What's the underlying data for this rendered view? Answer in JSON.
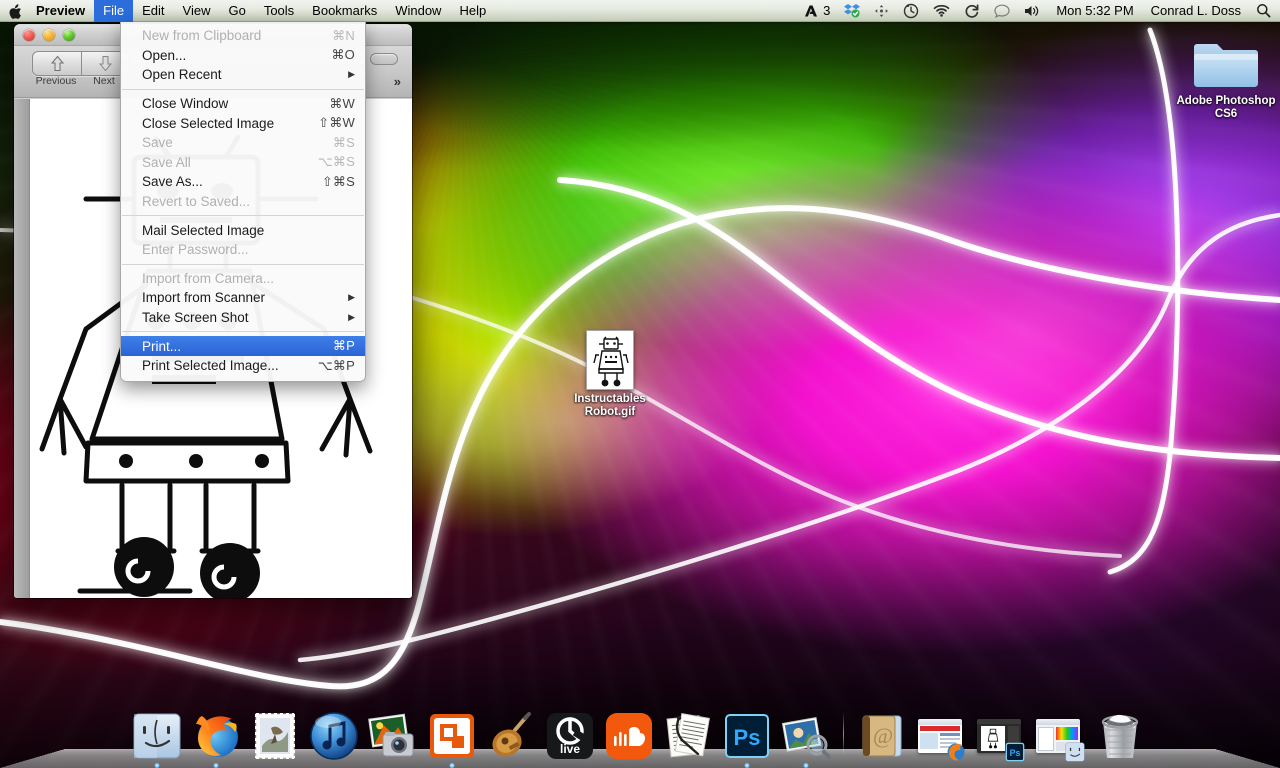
{
  "menubar": {
    "apple_icon": "apple-logo",
    "app_name": "Preview",
    "items": [
      {
        "label": "File",
        "active": true
      },
      {
        "label": "Edit",
        "active": false
      },
      {
        "label": "View",
        "active": false
      },
      {
        "label": "Go",
        "active": false
      },
      {
        "label": "Tools",
        "active": false
      },
      {
        "label": "Bookmarks",
        "active": false
      },
      {
        "label": "Window",
        "active": false
      },
      {
        "label": "Help",
        "active": false
      }
    ],
    "status_icons": [
      {
        "name": "adobe-creative-cloud-icon",
        "glyph": "A"
      },
      {
        "name": "notification-count",
        "glyph": "3"
      },
      {
        "name": "dropbox-icon",
        "glyph": "dropbox"
      },
      {
        "name": "bluetooth-share-icon",
        "glyph": "share"
      },
      {
        "name": "time-machine-icon",
        "glyph": "clock"
      },
      {
        "name": "wifi-icon",
        "glyph": "wifi"
      },
      {
        "name": "sync-icon",
        "glyph": "sync"
      },
      {
        "name": "messages-icon",
        "glyph": "bubble"
      },
      {
        "name": "volume-icon",
        "glyph": "speaker"
      }
    ],
    "clock": "Mon 5:32 PM",
    "user": "Conrad L. Doss",
    "search_icon": "spotlight-search-icon"
  },
  "file_menu": {
    "title": "File",
    "groups": [
      [
        {
          "label": "New from Clipboard",
          "key": "⌘N",
          "disabled": true,
          "submenu": false,
          "selected": false
        },
        {
          "label": "Open...",
          "key": "⌘O",
          "disabled": false,
          "submenu": false,
          "selected": false
        },
        {
          "label": "Open Recent",
          "key": "",
          "disabled": false,
          "submenu": true,
          "selected": false
        }
      ],
      [
        {
          "label": "Close Window",
          "key": "⌘W",
          "disabled": false,
          "submenu": false,
          "selected": false
        },
        {
          "label": "Close Selected Image",
          "key": "⇧⌘W",
          "disabled": false,
          "submenu": false,
          "selected": false
        },
        {
          "label": "Save",
          "key": "⌘S",
          "disabled": true,
          "submenu": false,
          "selected": false
        },
        {
          "label": "Save All",
          "key": "⌥⌘S",
          "disabled": true,
          "submenu": false,
          "selected": false
        },
        {
          "label": "Save As...",
          "key": "⇧⌘S",
          "disabled": false,
          "submenu": false,
          "selected": false
        },
        {
          "label": "Revert to Saved...",
          "key": "",
          "disabled": true,
          "submenu": false,
          "selected": false
        }
      ],
      [
        {
          "label": "Mail Selected Image",
          "key": "",
          "disabled": false,
          "submenu": false,
          "selected": false
        },
        {
          "label": "Enter Password...",
          "key": "",
          "disabled": true,
          "submenu": false,
          "selected": false
        }
      ],
      [
        {
          "label": "Import from Camera...",
          "key": "",
          "disabled": true,
          "submenu": false,
          "selected": false
        },
        {
          "label": "Import from Scanner",
          "key": "",
          "disabled": false,
          "submenu": true,
          "selected": false
        },
        {
          "label": "Take Screen Shot",
          "key": "",
          "disabled": false,
          "submenu": true,
          "selected": false
        }
      ],
      [
        {
          "label": "Print...",
          "key": "⌘P",
          "disabled": false,
          "submenu": false,
          "selected": true
        },
        {
          "label": "Print Selected Image...",
          "key": "⌥⌘P",
          "disabled": false,
          "submenu": false,
          "selected": false
        }
      ]
    ],
    "highlight_color": "#2a63d6"
  },
  "preview_window": {
    "traffic_lights": [
      "close-button",
      "minimize-button",
      "zoom-button"
    ],
    "toolbar": {
      "previous_label": "Previous",
      "next_label": "Next",
      "previous_icon": "up-arrow-icon",
      "next_icon": "down-arrow-icon",
      "overflow_label": "»"
    },
    "document": "Instructables Robot line drawing"
  },
  "desktop_icons": [
    {
      "name": "instructables-robot-gif",
      "label_line1": "Instructables",
      "label_line2": "Robot.gif",
      "type": "image-file"
    },
    {
      "name": "adobe-photoshop-cs6-folder",
      "label_line1": "Adobe Photoshop",
      "label_line2": "CS6",
      "type": "folder"
    }
  ],
  "dock": {
    "items": [
      {
        "name": "finder",
        "label": "Finder",
        "running": true
      },
      {
        "name": "firefox",
        "label": "Firefox",
        "running": true
      },
      {
        "name": "mail",
        "label": "Mail",
        "running": false
      },
      {
        "name": "itunes",
        "label": "iTunes",
        "running": false
      },
      {
        "name": "iphoto",
        "label": "iPhoto",
        "running": false
      },
      {
        "name": "transmit",
        "label": "Transmit",
        "running": true
      },
      {
        "name": "garageband",
        "label": "GarageBand",
        "running": false
      },
      {
        "name": "ableton-live",
        "label": "Ableton Live",
        "running": false
      },
      {
        "name": "soundcloud",
        "label": "SoundCloud",
        "running": false
      },
      {
        "name": "notes",
        "label": "Notes",
        "running": false
      },
      {
        "name": "photoshop",
        "label": "Adobe Photoshop CS6",
        "running": true
      },
      {
        "name": "preview",
        "label": "Preview",
        "running": true
      },
      {
        "name": "address-book",
        "label": "Address Book",
        "running": false
      }
    ],
    "minimized": [
      {
        "name": "minimized-firefox-window",
        "label": "Firefox window"
      },
      {
        "name": "minimized-photoshop-window",
        "label": "Photoshop window"
      },
      {
        "name": "minimized-finder-window",
        "label": "Finder window"
      }
    ],
    "trash": {
      "name": "trash",
      "label": "Trash",
      "full": true
    }
  },
  "wallpaper": {
    "name": "abstract-color-ribbons",
    "colors": [
      "#55e000",
      "#d8f000",
      "#ff9a00",
      "#ff27e0",
      "#b64cff",
      "#8e0018"
    ]
  }
}
